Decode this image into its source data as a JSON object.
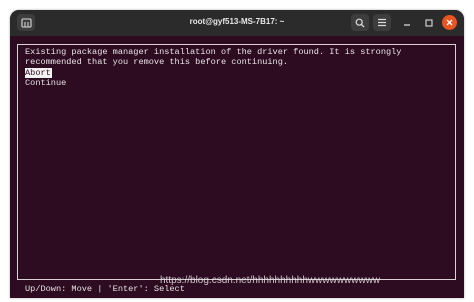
{
  "window": {
    "title": "root@gyf513-MS-7B17: ~",
    "accent_close": "#e95420",
    "terminal_bg": "#2d0c22",
    "titlebar_icons": [
      "new-tab-icon",
      "search-icon",
      "hamburger-menu-icon",
      "minimize-icon",
      "maximize-icon",
      "close-icon"
    ]
  },
  "dialog": {
    "message_line1": "Existing package manager installation of the driver found. It is strongly",
    "message_line2": "recommended that you remove this before continuing.",
    "options": [
      {
        "label": "Abort",
        "selected": true
      },
      {
        "label": "Continue",
        "selected": false
      }
    ]
  },
  "footer": {
    "hint": "Up/Down: Move | 'Enter': Select"
  },
  "watermark": {
    "text": "https://blog.csdn.net/hhhhhhhhhhwwwwwwwwww"
  }
}
